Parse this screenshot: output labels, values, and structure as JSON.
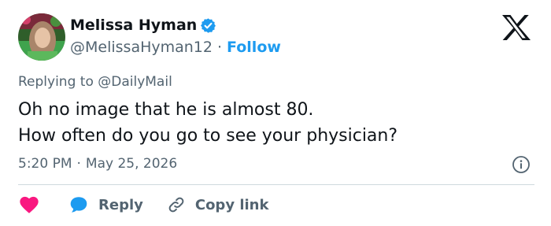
{
  "author": {
    "name": "Melissa Hyman",
    "handle": "@MelissaHyman12",
    "separator": "·",
    "follow_label": "Follow",
    "verified": true,
    "avatar_icon": "profile-photo"
  },
  "brand": {
    "logo_icon": "x-logo"
  },
  "reply_context": {
    "prefix": "Replying to",
    "mention": "@DailyMail"
  },
  "tweet": {
    "lines": [
      "Oh no image that he is almost 80.",
      "How often do you go to see your physician?"
    ]
  },
  "meta": {
    "time": "5:20 PM",
    "separator": "·",
    "date": "May 25, 2026",
    "info_icon": "info-icon"
  },
  "actions": {
    "like_icon": "heart-icon",
    "reply_label": "Reply",
    "reply_icon": "reply-bubble-icon",
    "copy_label": "Copy link",
    "copy_icon": "link-icon"
  },
  "colors": {
    "accent": "#1d9bf0",
    "like": "#f91880",
    "text": "#0f1419",
    "muted": "#536471",
    "divider": "#cfd9de"
  }
}
